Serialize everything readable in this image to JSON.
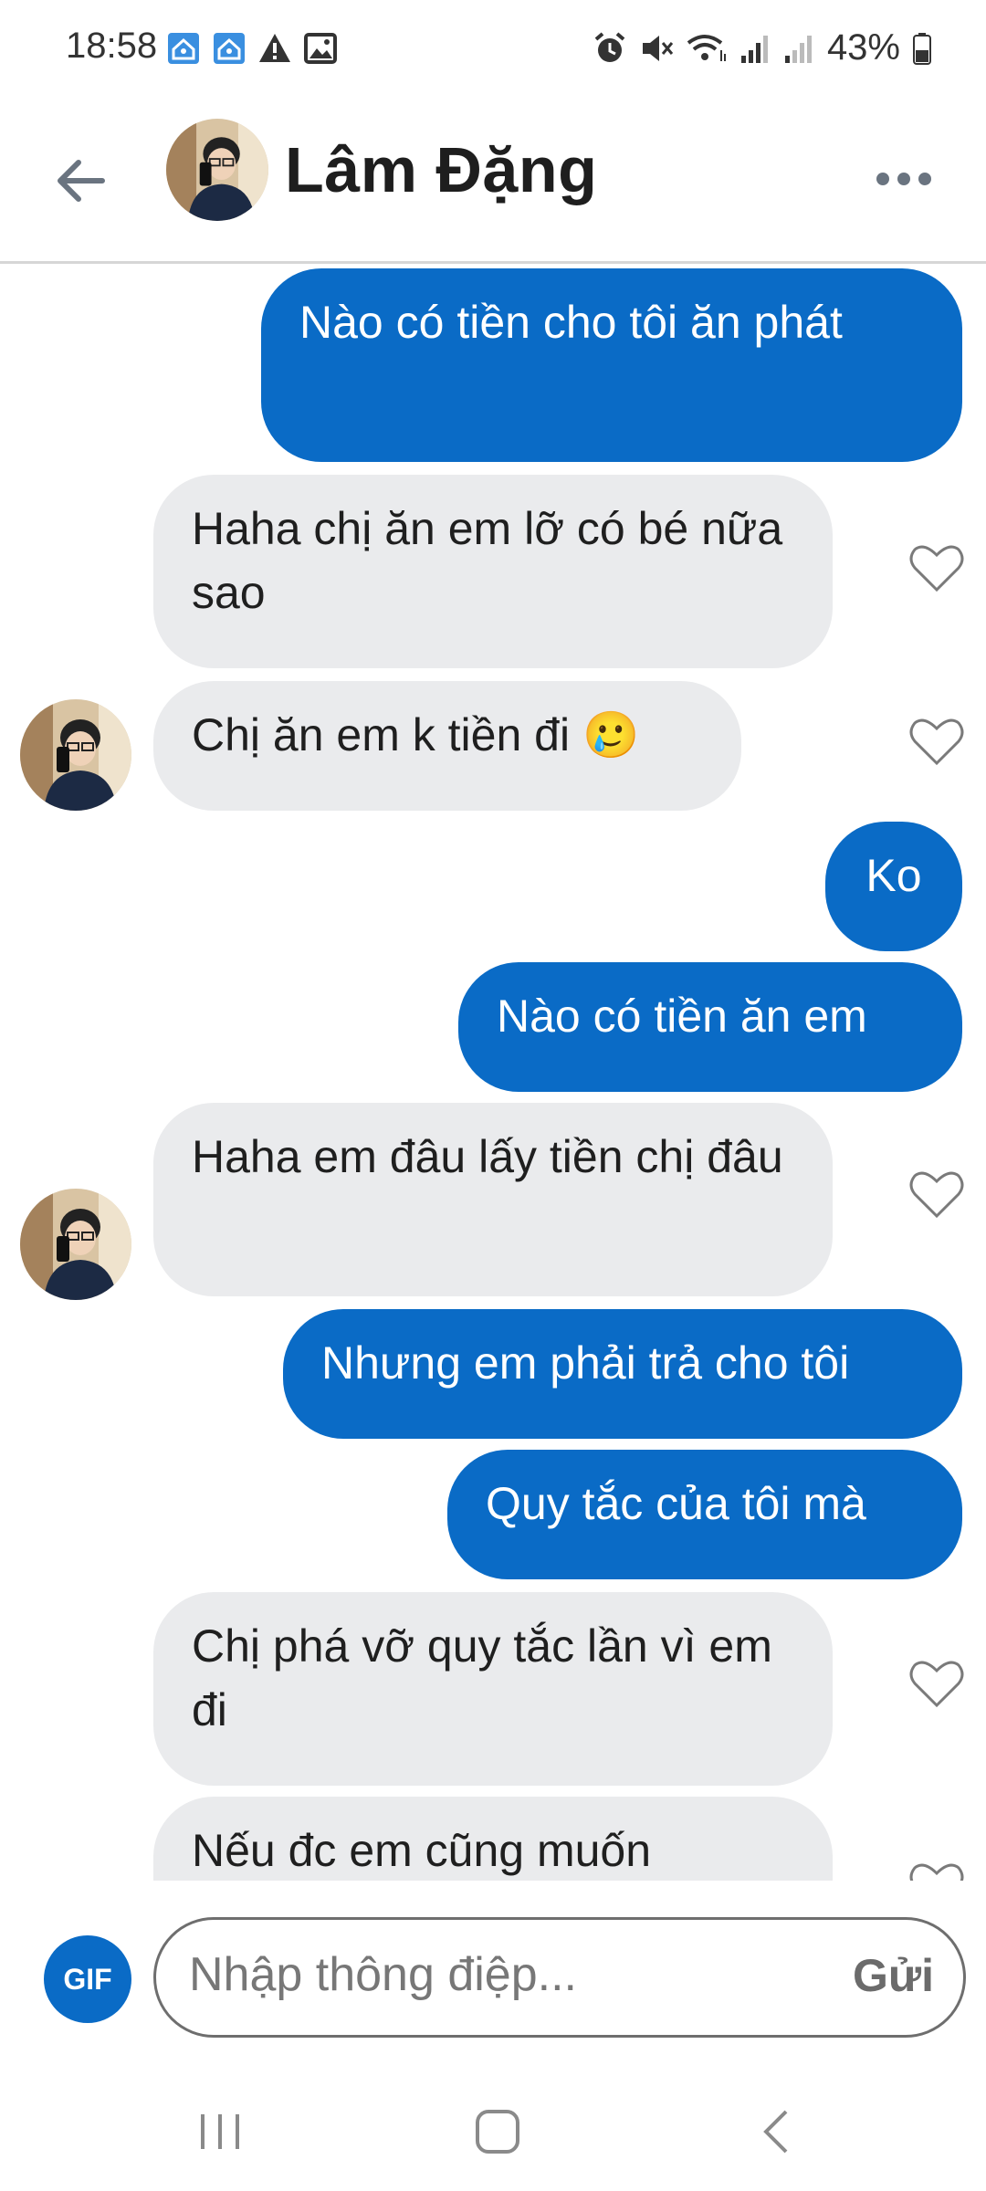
{
  "status_bar": {
    "time": "18:58",
    "battery": "43%",
    "left_icons": [
      "home-notification-icon",
      "home-notification-icon",
      "warning-icon",
      "image-icon"
    ],
    "right_icons": [
      "alarm-icon",
      "mute-icon",
      "wifi-icon",
      "signal-icon",
      "signal-icon",
      "battery-icon"
    ]
  },
  "header": {
    "contact_name": "Lâm Đặng",
    "back_icon": "arrow-left-icon",
    "more_icon": "more-horizontal-icon"
  },
  "messages": [
    {
      "dir": "out",
      "text": "Nào có tiền cho tôi ăn phát"
    },
    {
      "dir": "in",
      "text": "Haha chị ăn em lỡ có bé nữa sao"
    },
    {
      "dir": "in",
      "text": "Chị ăn em k tiền đi 🥲"
    },
    {
      "dir": "out",
      "text": "Ko"
    },
    {
      "dir": "out",
      "text": "Nào có tiền ăn em"
    },
    {
      "dir": "in",
      "text": "Haha em đâu lấy tiền chị đâu"
    },
    {
      "dir": "out",
      "text": "Nhưng em phải trả cho tôi"
    },
    {
      "dir": "out",
      "text": "Quy tắc của tôi mà"
    },
    {
      "dir": "in",
      "text": "Chị phá vỡ quy tắc lần vì em đi"
    },
    {
      "dir": "in",
      "text": "Nếu đc em cũng muốn"
    }
  ],
  "composer": {
    "gif_label": "GIF",
    "placeholder": "Nhập thông điệp...",
    "send_label": "Gửi"
  },
  "colors": {
    "accent": "#0a6bc6",
    "incoming_bubble": "#eaebed"
  }
}
